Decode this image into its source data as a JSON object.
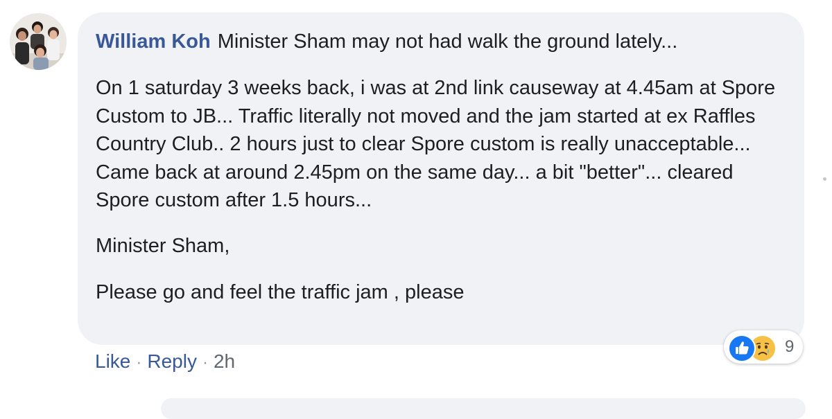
{
  "comment": {
    "author": "William Koh",
    "first_line": "Minister Sham may not had walk the ground lately...",
    "paragraphs": [
      "On 1 saturday 3 weeks back, i was at 2nd link causeway at 4.45am at Spore Custom to JB... Traffic literally not moved and the jam started at ex Raffles Country Club.. 2 hours just to clear Spore custom is really unacceptable... Came back at around 2.45pm on the same day... a bit \"better\"... cleared Spore custom after 1.5 hours...",
      "Minister Sham,",
      "Please go and feel the traffic jam , please"
    ],
    "actions": {
      "like": "Like",
      "separator": "·",
      "reply": "Reply",
      "time": "2h"
    },
    "reactions": {
      "icons": [
        "like-icon",
        "sad-icon"
      ],
      "count": "9"
    }
  },
  "colors": {
    "author": "#385898",
    "bubble": "#f0f2f5",
    "text": "#1c1e21",
    "like": "#1877f2",
    "sad": "#f7c145"
  }
}
